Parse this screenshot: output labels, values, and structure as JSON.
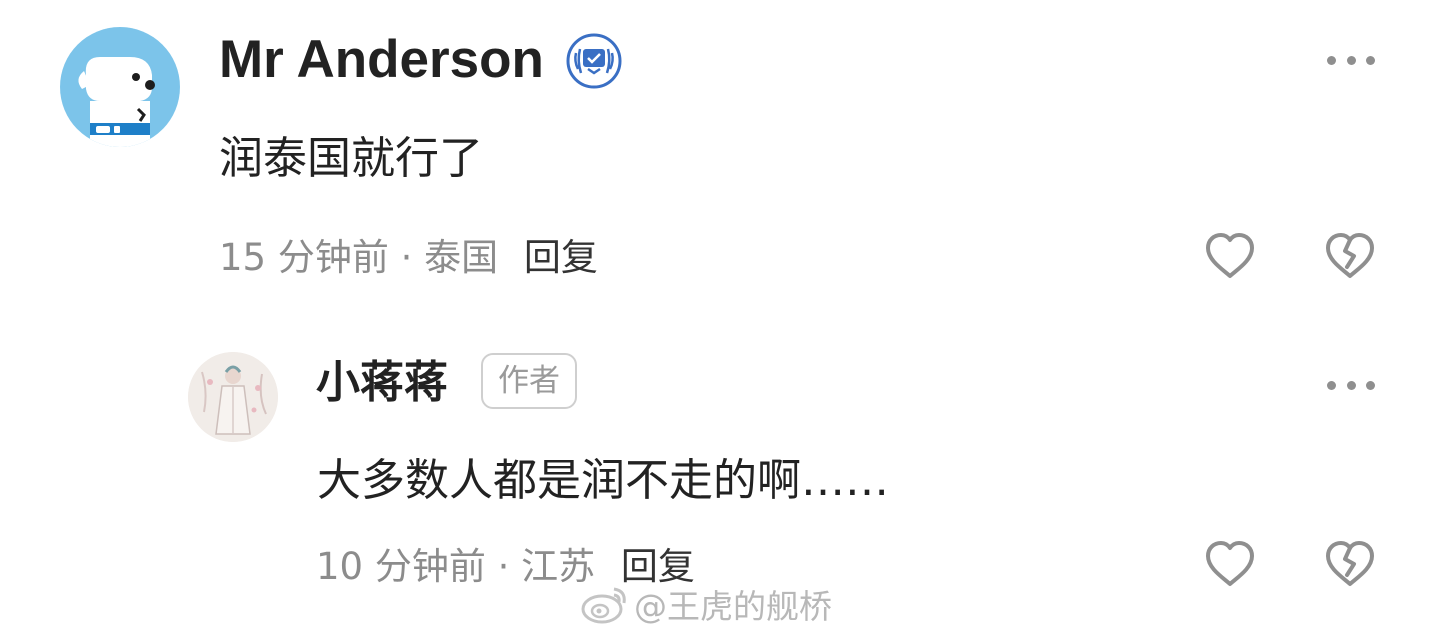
{
  "comments": [
    {
      "username": "Mr Anderson",
      "text": "润泰国就行了",
      "time": "15 分钟前",
      "location": "泰国",
      "reply_label": "回复",
      "icons": [
        "avatar-dog",
        "verified-badge-icon",
        "more-icon",
        "heart-icon",
        "broken-heart-icon"
      ]
    },
    {
      "username": "小蒋蒋",
      "badge": "作者",
      "text": "大多数人都是润不走的啊……",
      "time": "10 分钟前",
      "location": "江苏",
      "reply_label": "回复",
      "icons": [
        "avatar-illustration",
        "more-icon",
        "heart-icon",
        "broken-heart-icon"
      ]
    }
  ],
  "meta_separator": "·",
  "watermark": "@王虎的舰桥",
  "colors": {
    "text": "#222222",
    "meta": "#8c8c8c",
    "icon": "#8f8f8f",
    "avatar_bg": "#7cc4ea",
    "verified": "#3a6fc4"
  }
}
